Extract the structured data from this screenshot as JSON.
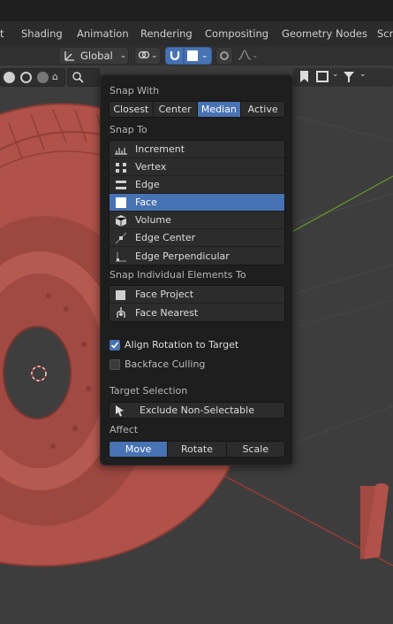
{
  "workspace_tabs": [
    "t",
    "Shading",
    "Animation",
    "Rendering",
    "Compositing",
    "Geometry Nodes",
    "Scri"
  ],
  "header": {
    "orientation_label": "Global",
    "snap_active": true,
    "accent": "#4772b3"
  },
  "popup": {
    "snap_with": {
      "label": "Snap With",
      "options": [
        "Closest",
        "Center",
        "Median",
        "Active"
      ],
      "selected": "Median"
    },
    "snap_to": {
      "label": "Snap To",
      "items": [
        {
          "label": "Increment",
          "icon": "increment-icon",
          "selected": false
        },
        {
          "label": "Vertex",
          "icon": "vertex-icon",
          "selected": false
        },
        {
          "label": "Edge",
          "icon": "edge-icon",
          "selected": false
        },
        {
          "label": "Face",
          "icon": "face-icon",
          "selected": true
        },
        {
          "label": "Volume",
          "icon": "volume-icon",
          "selected": false
        },
        {
          "label": "Edge Center",
          "icon": "edge-center-icon",
          "selected": false
        },
        {
          "label": "Edge Perpendicular",
          "icon": "edge-perpendicular-icon",
          "selected": false
        }
      ]
    },
    "snap_individual": {
      "label": "Snap Individual Elements To",
      "items": [
        {
          "label": "Face Project",
          "icon": "face-project-icon"
        },
        {
          "label": "Face Nearest",
          "icon": "face-nearest-icon"
        }
      ]
    },
    "align_rotation": {
      "label": "Align Rotation to Target",
      "checked": true
    },
    "backface_culling": {
      "label": "Backface Culling",
      "checked": false
    },
    "target_selection": {
      "label": "Target Selection",
      "button": "Exclude Non-Selectable"
    },
    "affect": {
      "label": "Affect",
      "options": [
        "Move",
        "Rotate",
        "Scale"
      ],
      "selected": "Move"
    }
  },
  "colors": {
    "tire": "#b0524a",
    "grid_green": "#6a9a2a",
    "grid_red": "#b03a3a",
    "popup_bg": "#1e1e1e"
  }
}
